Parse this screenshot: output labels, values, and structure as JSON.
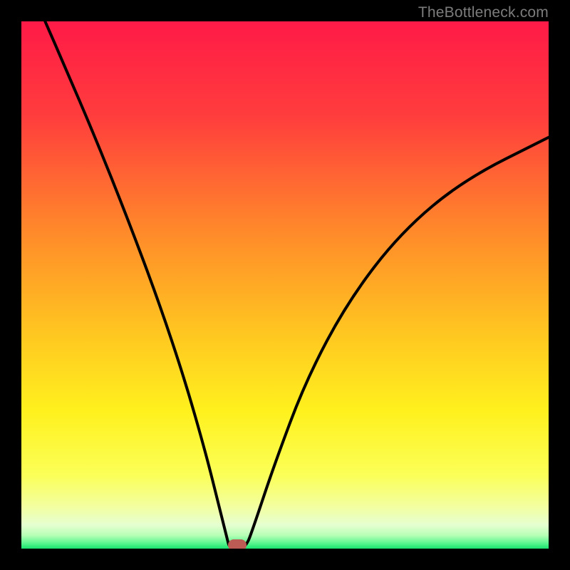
{
  "attribution": "TheBottleneck.com",
  "colors": {
    "frame": "#000000",
    "marker": "#bb5b53",
    "gradient_stops": [
      {
        "pos": 0.0,
        "color": "#ff1a47"
      },
      {
        "pos": 0.18,
        "color": "#ff3d3d"
      },
      {
        "pos": 0.4,
        "color": "#ff8a2a"
      },
      {
        "pos": 0.58,
        "color": "#ffc321"
      },
      {
        "pos": 0.74,
        "color": "#fff11e"
      },
      {
        "pos": 0.86,
        "color": "#fbff57"
      },
      {
        "pos": 0.92,
        "color": "#f3ffa0"
      },
      {
        "pos": 0.955,
        "color": "#e6ffd0"
      },
      {
        "pos": 0.975,
        "color": "#b6ffb6"
      },
      {
        "pos": 0.99,
        "color": "#58f58d"
      },
      {
        "pos": 1.0,
        "color": "#19e26f"
      }
    ]
  },
  "chart_data": {
    "type": "line",
    "title": "",
    "xlabel": "",
    "ylabel": "",
    "xlim": [
      0,
      100
    ],
    "ylim": [
      0,
      100
    ],
    "curve_points": [
      {
        "x": 4.5,
        "y": 100
      },
      {
        "x": 8,
        "y": 92
      },
      {
        "x": 14,
        "y": 78
      },
      {
        "x": 20,
        "y": 63
      },
      {
        "x": 26,
        "y": 47
      },
      {
        "x": 31,
        "y": 32
      },
      {
        "x": 35,
        "y": 18
      },
      {
        "x": 37.5,
        "y": 8
      },
      {
        "x": 39,
        "y": 2
      },
      {
        "x": 39.5,
        "y": 0
      },
      {
        "x": 42.5,
        "y": 0
      },
      {
        "x": 44,
        "y": 4
      },
      {
        "x": 48,
        "y": 16
      },
      {
        "x": 54,
        "y": 32
      },
      {
        "x": 62,
        "y": 47
      },
      {
        "x": 72,
        "y": 60
      },
      {
        "x": 84,
        "y": 70
      },
      {
        "x": 100,
        "y": 78
      }
    ],
    "marker": {
      "x": 41,
      "y": 0.7
    }
  }
}
